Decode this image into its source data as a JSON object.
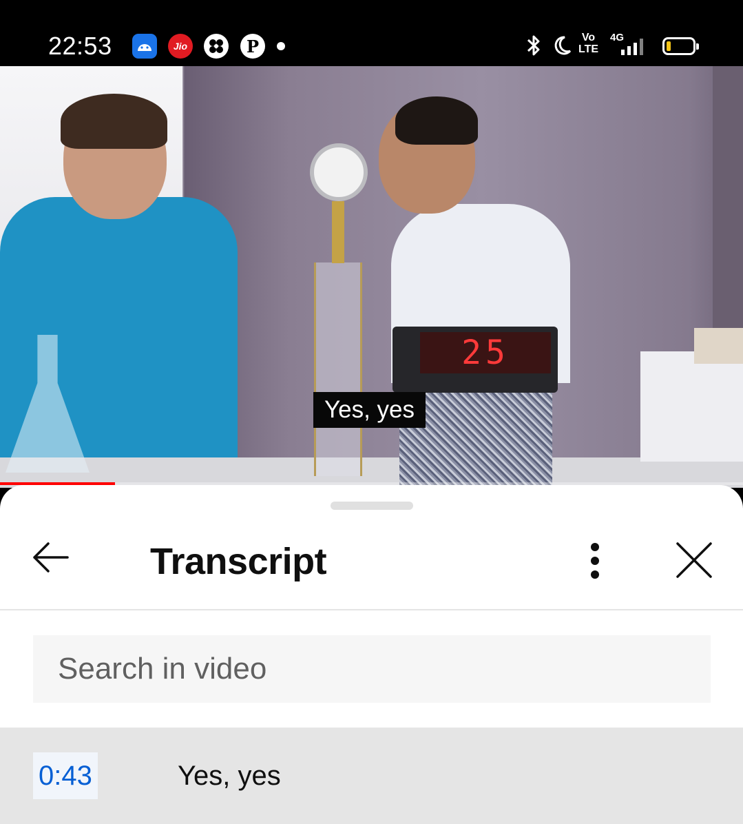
{
  "status_bar": {
    "time": "22:53",
    "notifications": [
      "android-icon",
      "jio-icon",
      "fan-icon",
      "pinterest-icon"
    ],
    "jio_label": "Jio",
    "pinterest_glyph": "P",
    "volte_label": "Vo\nLTE",
    "network_label": "4G",
    "battery_level": 0.15
  },
  "video": {
    "subtitle": "Yes, yes",
    "display_reading": "25",
    "progress": 0.155,
    "colors": {
      "progress": "#ff0000"
    }
  },
  "transcript_panel": {
    "title": "Transcript",
    "search_placeholder": "Search in video",
    "segments": [
      {
        "time": "0:43",
        "text": "Yes, yes"
      }
    ],
    "colors": {
      "timestamp": "#065fd4",
      "active_row": "#e5e5e5"
    }
  }
}
